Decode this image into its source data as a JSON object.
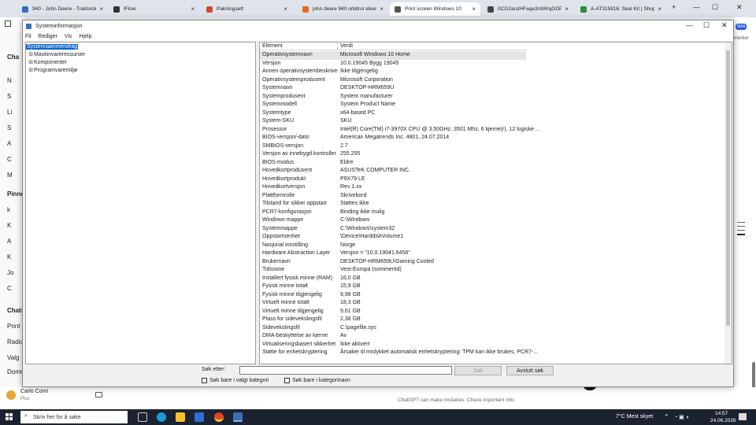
{
  "browser": {
    "tabs": [
      {
        "label": "940 - John Deere - Traktordele",
        "fav": "#2d6ec0",
        "active": false
      },
      {
        "label": "IFlow",
        "fav": "#333333",
        "active": false
      },
      {
        "label": "Pakningsett",
        "fav": "#d04a2e",
        "active": false
      },
      {
        "label": "john deere 940 orbitrol steering",
        "fav": "#e06a20",
        "active": false
      },
      {
        "label": "Print screen Windows 10",
        "fav": "#555555",
        "active": true
      },
      {
        "label": "0CG2acdHFaqe3nWKqGDPFX",
        "fav": "#444444",
        "active": false
      },
      {
        "label": "A-AT315816: Seal Kit | Shop.De",
        "fav": "#2e8b3a",
        "active": false
      }
    ]
  },
  "chatgpt": {
    "sidebar_items": [
      "Cha",
      "N",
      "S",
      "Li",
      "S",
      "A",
      "C",
      "M",
      "Pinne",
      "k",
      "K",
      "A",
      "K",
      "Jo",
      "C",
      "Chats",
      "Print s",
      "Radio",
      "Valg",
      "Domn"
    ],
    "user": {
      "name": "Carlo Comi",
      "plan": "Plus"
    },
    "disclaimer": "ChatGPT can make mistakes. Check important info.",
    "right_labels": [
      "tere",
      "merker"
    ]
  },
  "sysinfo": {
    "title": "Systeminformasjon",
    "menu": [
      "Fil",
      "Rediger",
      "Vis",
      "Hjelp"
    ],
    "tree": [
      {
        "label": "Systemsammendrag",
        "expander": "",
        "selected": true
      },
      {
        "label": "Maskinvareressurser",
        "expander": "⊞",
        "selected": false
      },
      {
        "label": "Komponenter",
        "expander": "⊞",
        "selected": false
      },
      {
        "label": "Programvaremiljø",
        "expander": "⊞",
        "selected": false
      }
    ],
    "columns": [
      "Element",
      "Verdi"
    ],
    "rows": [
      [
        "Operativsystemnavn",
        "Microsoft Windows 10 Home"
      ],
      [
        "Versjon",
        "10.0.19045 Bygg 19045"
      ],
      [
        "Annen operativsystembeskrivel...",
        "Ikke tilgjengelig"
      ],
      [
        "Operativsystemprodusent",
        "Microsoft Corporation"
      ],
      [
        "Systemnavn",
        "DESKTOP-HRM659U"
      ],
      [
        "Systemprodusent",
        "System manufacturer"
      ],
      [
        "Systemmodell",
        "System Product Name"
      ],
      [
        "Systemtype",
        "x64-based PC"
      ],
      [
        "System-SKU",
        "SKU"
      ],
      [
        "Prosessor",
        "Intel(R) Core(TM) i7-3970X CPU @ 3.50GHz, 3501 Mhz, 6 kjerne(r), 12 logiske ..."
      ],
      [
        "BIOS-versjon/-dato",
        "American Megatrends Inc. 4801, 24.07.2014"
      ],
      [
        "SMBIOS-versjon",
        "2.7"
      ],
      [
        "Versjon av innebygd kontroller",
        "255.255"
      ],
      [
        "BIOS-modus",
        "Eldre"
      ],
      [
        "Hovedkortprodusent",
        "ASUSTeK COMPUTER INC."
      ],
      [
        "Hovedkortprodukt",
        "P9X79 LE"
      ],
      [
        "Hovedkortversjon",
        "Rev 1.xx"
      ],
      [
        "Plattformrolle",
        "Skrivebord"
      ],
      [
        "Tilstand for sikker oppstart",
        "Støttes ikke"
      ],
      [
        "PCR7-konfigurasjon",
        "Binding ikke mulig"
      ],
      [
        "Windows-mappe",
        "C:\\Windows"
      ],
      [
        "Systemmappe",
        "C:\\Windows\\system32"
      ],
      [
        "Oppstartsenhet",
        "\\Device\\HarddiskVolume1"
      ],
      [
        "Nasjonal innstilling",
        "Norge"
      ],
      [
        "Hardware Abstraction Layer",
        "Versjon = \"10.0.19041.6456\""
      ],
      [
        "Brukernavn",
        "DESKTOP-HRM659U\\Gaming Cooled"
      ],
      [
        "Tidssone",
        "Vest-Europa (sommertid)"
      ],
      [
        "Installert fysisk minne (RAM)",
        "16,0 GB"
      ],
      [
        "Fysisk minne totalt",
        "15,9 GB"
      ],
      [
        "Fysisk minne tilgjengelig",
        "9,98 GB"
      ],
      [
        "Virtuelt minne totalt",
        "18,3 GB"
      ],
      [
        "Virtuelt minne tilgjengelig",
        "9,61 GB"
      ],
      [
        "Plass for sidevekslingsfil",
        "2,38 GB"
      ],
      [
        "Sidevekslingsfil",
        "C:\\pagefile.sys"
      ],
      [
        "DMA-beskyttelse av kjerne",
        "Av"
      ],
      [
        "Virtualiseringsbasert sikkerhet",
        "Ikke aktivert"
      ],
      [
        "Støtte for enhetskryptering",
        "Årsaker til mislykket automatisk enhetskryptering: TPM kan ikke brukes, PCR7-..."
      ]
    ],
    "search_label": "Søk etter:",
    "search_value": "",
    "find_button": "Søk",
    "close_find_button": "Avslutt søk",
    "chk_selected": "Søk bare i valgt kategori",
    "chk_names": "Søk bare i kategorinavn"
  },
  "taskbar": {
    "search_placeholder": "Skriv her for å søke",
    "weather": "7°C  Mest skyet",
    "time": "14:57",
    "date": "24.06.2026"
  }
}
